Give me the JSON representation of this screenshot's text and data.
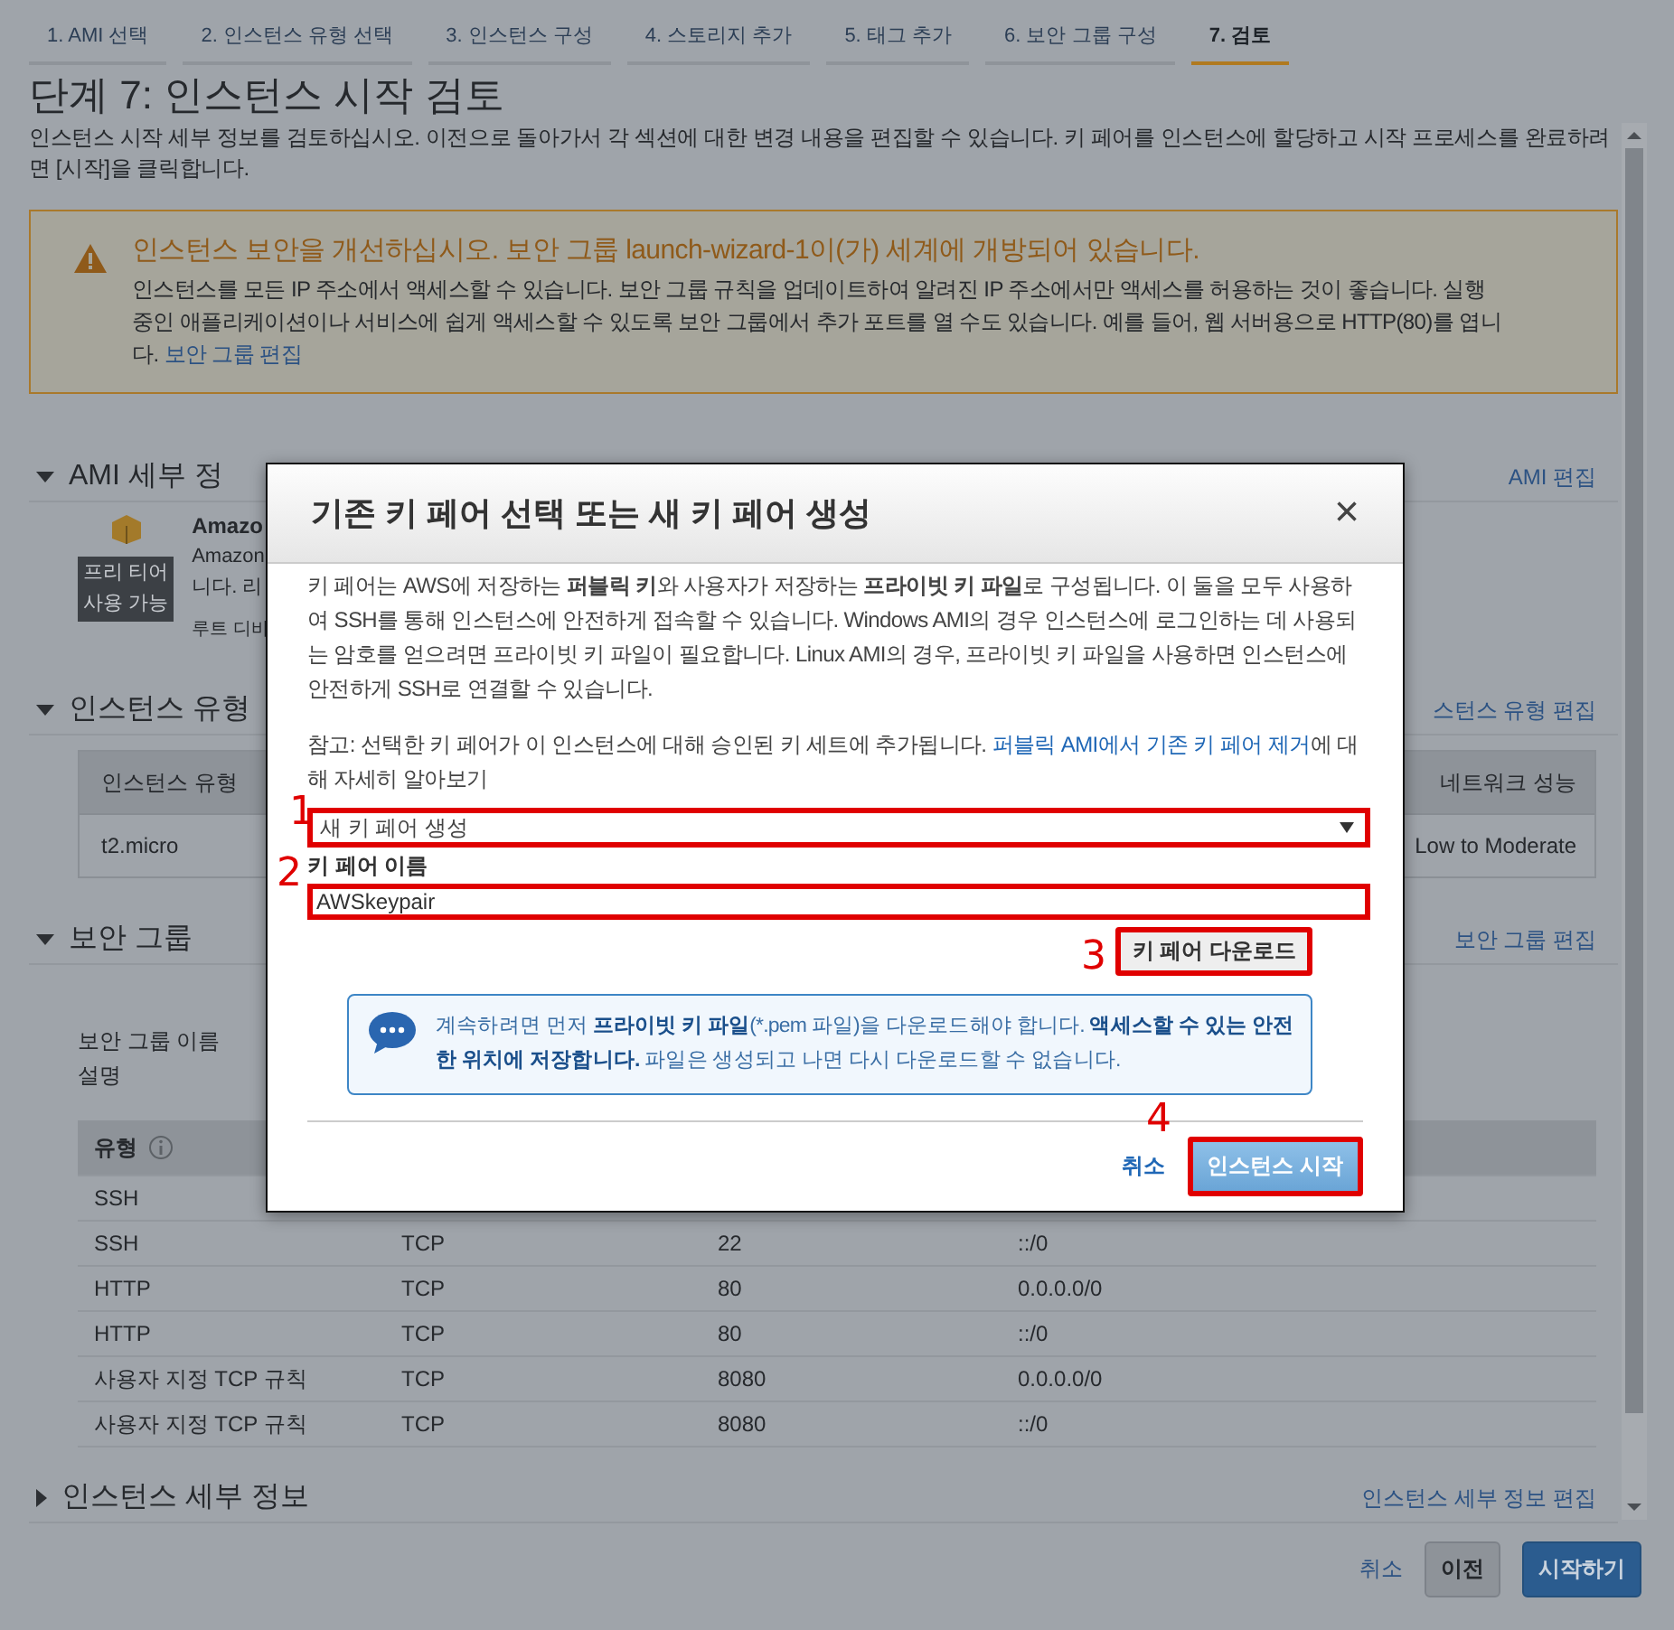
{
  "wizard_steps": [
    {
      "label": "1. AMI 선택",
      "selected": false
    },
    {
      "label": "2. 인스턴스 유형 선택",
      "selected": false
    },
    {
      "label": "3. 인스턴스 구성",
      "selected": false
    },
    {
      "label": "4. 스토리지 추가",
      "selected": false
    },
    {
      "label": "5. 태그 추가",
      "selected": false
    },
    {
      "label": "6. 보안 그룹 구성",
      "selected": false
    },
    {
      "label": "7. 검토",
      "selected": true
    }
  ],
  "page": {
    "title": "단계 7: 인스턴스 시작 검토",
    "description": "인스턴스 시작 세부 정보를 검토하십시오. 이전으로 돌아가서 각 섹션에 대한 변경 내용을 편집할 수 있습니다. 키 페어를 인스턴스에 할당하고 시작 프로세스를 완료하려면 [시작]을 클릭합니다."
  },
  "warning": {
    "title": "인스턴스 보안을 개선하십시오. 보안 그룹 launch-wizard-1이(가) 세계에 개방되어 있습니다.",
    "body": "인스턴스를 모든 IP 주소에서 액세스할 수 있습니다. 보안 그룹 규칙을 업데이트하여 알려진 IP 주소에서만 액세스를 허용하는 것이 좋습니다. 실행 중인 애플리케이션이나 서비스에 쉽게 액세스할 수 있도록 보안 그룹에서 추가 포트를 열 수도 있습니다. 예를 들어, 웹 서버용으로 HTTP(80)를 엽니다.",
    "link": "보안 그룹 편집"
  },
  "sections": [
    {
      "kind": "ami",
      "title": "AMI 세부 정",
      "expanded": true,
      "edit_link": "AMI 편집",
      "badge_lines": [
        "프리 티어",
        "사용 가능"
      ],
      "name": "Amazo",
      "lines": [
        "Amazon",
        "니다. 리"
      ],
      "note": "루트 디바"
    },
    {
      "kind": "instance_type",
      "title": "인스턴스 유형",
      "expanded": true,
      "edit_link": "스턴스 유형 편집",
      "table": {
        "columns": [
          "인스턴스 유형",
          "네트워크 성능"
        ],
        "rows": [
          [
            "t2.micro",
            "Low to Moderate"
          ]
        ]
      }
    },
    {
      "kind": "security_group",
      "title": "보안 그룹",
      "expanded": true,
      "edit_link": "보안 그룹 편집",
      "fields": [
        "보안 그룹 이름",
        "설명"
      ],
      "table": {
        "columns": [
          "유형"
        ],
        "rows": [
          [
            "SSH"
          ],
          [
            "SSH",
            "TCP",
            "22",
            "::/0"
          ],
          [
            "HTTP",
            "TCP",
            "80",
            "0.0.0.0/0"
          ],
          [
            "HTTP",
            "TCP",
            "80",
            "::/0"
          ],
          [
            "사용자 지정 TCP 규칙",
            "TCP",
            "8080",
            "0.0.0.0/0"
          ],
          [
            "사용자 지정 TCP 규칙",
            "TCP",
            "8080",
            "::/0"
          ]
        ]
      }
    },
    {
      "kind": "instance_details",
      "title": "인스턴스 세부 정보",
      "expanded": false,
      "edit_link": "인스턴스 세부 정보 편집"
    }
  ],
  "footer": {
    "cancel": "취소",
    "previous": "이전",
    "launch": "시작하기"
  },
  "modal": {
    "title": "기존 키 페어 선택 또는 새 키 페어 생성",
    "close": "×",
    "intro": "키 페어는 AWS에 저장하는 **퍼블릭 키**와 사용자가 저장하는 **프라이빗 키 파일**로 구성됩니다. 이 둘을 모두 사용하여 SSH를 통해 인스턴스에 안전하게 접속할 수 있습니다. Windows AMI의 경우 인스턴스에 로그인하는 데 사용되는 암호를 얻으려면 프라이빗 키 파일이 필요합니다. Linux AMI의 경우, 프라이빗 키 파일을 사용하면 인스턴스에 안전하게 SSH로 연결할 수 있습니다.",
    "note": "참고: 선택한 키 페어가 이 인스턴스에 대해 승인된 키 세트에 추가됩니다.",
    "note_link": "퍼블릭 AMI에서 기존 키 페어 제거",
    "note_end": "에 대해 자세히 알아보기",
    "key_pair_option": {
      "value": "새 키 페어 생성",
      "highlighted": true,
      "annotation": "1"
    },
    "key_pair_name": {
      "label": "키 페어 이름",
      "value": "AWSkeypair",
      "highlighted": true,
      "annotation": "2"
    },
    "download_button": {
      "label": "키 페어 다운로드",
      "highlighted": true,
      "annotation": "3"
    },
    "info": "계속하려면 먼저 **프라이빗 키 파일**(*.pem 파일)을 다운로드해야 합니다. **액세스할 수 있는 안전한 위치에 저장합니다.** 파일은 생성되고 나면 다시 다운로드할 수 없습니다.",
    "cancel": "취소",
    "launch": {
      "label": "인스턴스 시작",
      "highlighted": true,
      "annotation": "4"
    }
  }
}
